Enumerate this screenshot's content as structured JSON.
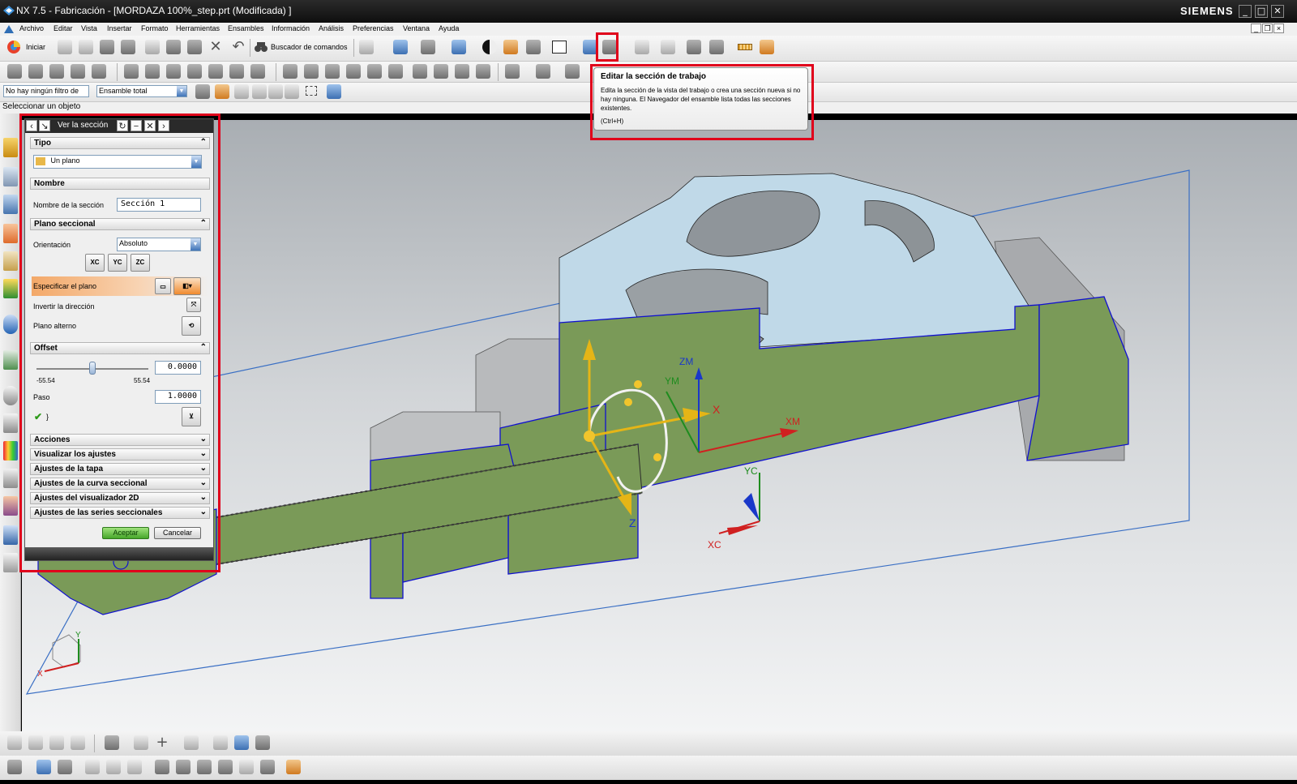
{
  "window": {
    "title": "NX 7.5 - Fabricación - [MORDAZA 100%_step.prt (Modificada) ]",
    "brand": "SIEMENS",
    "controls": [
      "_",
      "□",
      "✕"
    ]
  },
  "menubar": {
    "items": [
      "Archivo",
      "Editar",
      "Vista",
      "Insertar",
      "Formato",
      "Herramientas",
      "Ensambles",
      "Información",
      "Análisis",
      "Preferencias",
      "Ventana",
      "Ayuda"
    ]
  },
  "toolbar": {
    "start_label": "Iniciar",
    "command_finder_label": "Buscador de comandos",
    "filter_combo": "No hay ningún filtro de",
    "assembly_combo": "Ensamble total"
  },
  "status": {
    "prompt": "Seleccionar un objeto"
  },
  "tooltip": {
    "title": "Editar la sección de trabajo",
    "body": "Edita la sección de la vista del trabajo o crea una sección nueva si no hay ninguna. El Navegador del ensamble lista todas las secciones existentes.",
    "shortcut": "(Ctrl+H)"
  },
  "dialog": {
    "title": "Ver la sección",
    "tipo": {
      "header": "Tipo",
      "value": "Un plano"
    },
    "nombre": {
      "header": "Nombre",
      "label": "Nombre de la sección",
      "value": "Sección 1"
    },
    "plano": {
      "header": "Plano seccional",
      "orientation_label": "Orientación",
      "orientation_value": "Absoluto",
      "axis_buttons": [
        "XC",
        "YC",
        "ZC"
      ],
      "specify_label": "Especificar el plano",
      "invert_label": "Invertir la dirección",
      "alternate_label": "Plano alterno"
    },
    "offset": {
      "header": "Offset",
      "value": "0.0000",
      "min": "-55.54",
      "max": "55.54",
      "slider_fraction": 0.5,
      "step_label": "Paso",
      "step_value": "1.0000",
      "check_label": "}"
    },
    "collapsed_sections": [
      "Acciones",
      "Visualizar los ajustes",
      "Ajustes de la tapa",
      "Ajustes de la curva seccional",
      "Ajustes del visualizador 2D",
      "Ajustes de las series seccionales"
    ],
    "ok_label": "Aceptar",
    "cancel_label": "Cancelar"
  },
  "viewport_labels": {
    "x": "X",
    "z": "Z",
    "xm": "XM",
    "ym": "YM",
    "zm": "ZM",
    "xc": "XC",
    "yc": "YC",
    "triad_x": "X",
    "triad_y": "Y"
  },
  "colors": {
    "section_fill": "#7a9a58",
    "section_edge": "#1010d0",
    "highlight_red": "#e0001b",
    "part_top": "#bcd6e6"
  }
}
